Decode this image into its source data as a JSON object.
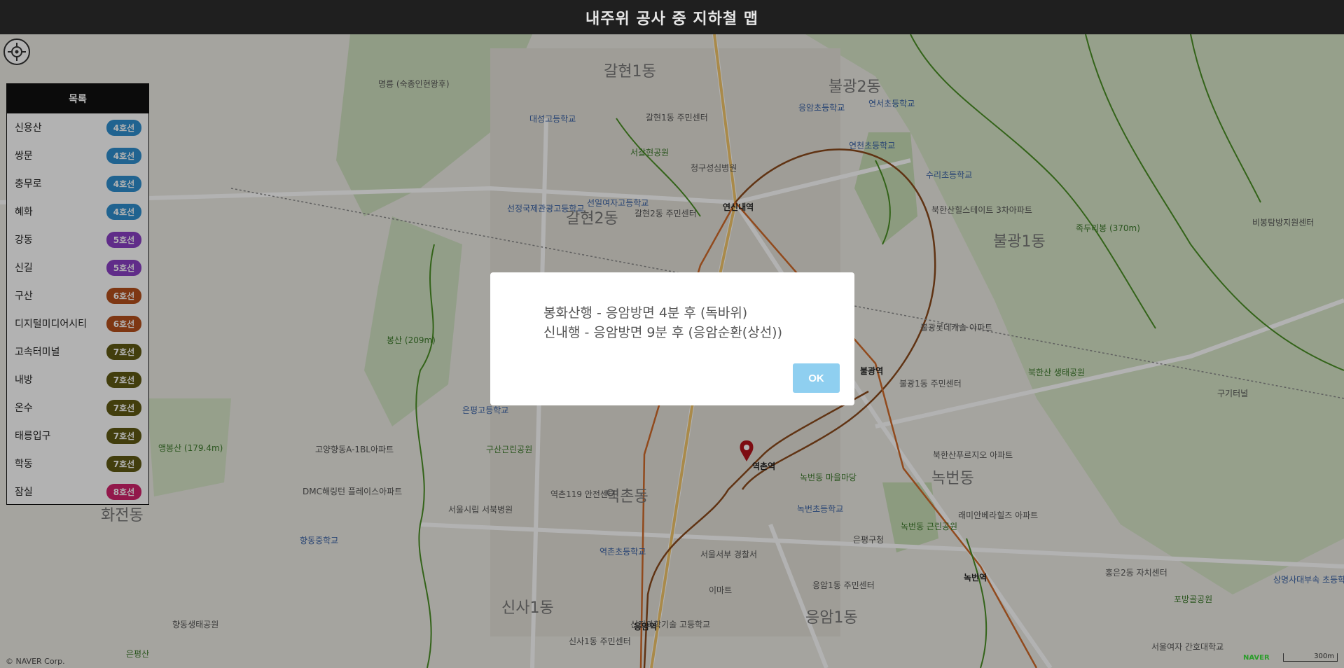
{
  "header": {
    "title": "내주위 공사 중 지하철 맵"
  },
  "panel": {
    "title": "목록",
    "items": [
      {
        "name": "신용산",
        "line": "4호선",
        "color": "#2e8fcf"
      },
      {
        "name": "쌍문",
        "line": "4호선",
        "color": "#2e8fcf"
      },
      {
        "name": "충무로",
        "line": "4호선",
        "color": "#2e8fcf"
      },
      {
        "name": "혜화",
        "line": "4호선",
        "color": "#2e8fcf"
      },
      {
        "name": "강동",
        "line": "5호선",
        "color": "#8a3fc4"
      },
      {
        "name": "신길",
        "line": "5호선",
        "color": "#8a3fc4"
      },
      {
        "name": "구산",
        "line": "6호선",
        "color": "#b5501c"
      },
      {
        "name": "디지털미디어시티",
        "line": "6호선",
        "color": "#b5501c"
      },
      {
        "name": "고속터미널",
        "line": "7호선",
        "color": "#5f5a14"
      },
      {
        "name": "내방",
        "line": "7호선",
        "color": "#5f5a14"
      },
      {
        "name": "온수",
        "line": "7호선",
        "color": "#5f5a14"
      },
      {
        "name": "태릉입구",
        "line": "7호선",
        "color": "#5f5a14"
      },
      {
        "name": "학동",
        "line": "7호선",
        "color": "#5f5a14"
      },
      {
        "name": "잠실",
        "line": "8호선",
        "color": "#d2236c"
      }
    ]
  },
  "dialog": {
    "line1": "봉화산행 - 응암방면 4분 후 (독바위)",
    "line2": "신내행 - 응암방면 9분 후 (응암순환(상선))",
    "ok_label": "OK"
  },
  "map": {
    "districts": [
      "갈현1동",
      "갈현2동",
      "불광2동",
      "불광1동",
      "역촌동",
      "녹번동",
      "신사1동",
      "응암1동",
      "화전동"
    ],
    "stations": [
      "연신내역",
      "불광역",
      "역촌역",
      "녹번역",
      "응암역"
    ],
    "pois": [
      "명릉 (숙종인현왕후)",
      "대성고등학교",
      "서갈현공원",
      "청구성심병원",
      "선일여자고등학교",
      "갈현2동 주민센터",
      "선정국제관광고등학교",
      "수리초등학교",
      "북한산힐스테이트 3차아파트",
      "족두리봉 (370m)",
      "비봉탐방지원센터",
      "봉산 (209m)",
      "은평고등학교",
      "구산근린공원",
      "역촌119 안전센터",
      "서울시립 서북병원",
      "고양향동A-1BL아파트",
      "DMC해링턴 플레이스아파트",
      "향동중학교",
      "역촌초등학교",
      "녹번초등학교",
      "은평구청",
      "서울서부 경찰서",
      "이마트",
      "신진과학기술 고등학교",
      "신사1동 주민센터",
      "응암1동 주민센터",
      "북한산푸르지오 아파트",
      "래미안베라힐즈 아파트",
      "홍은2동 자치센터",
      "포방골공원",
      "상명사대부속 초등학교",
      "서울여자 간호대학교",
      "앵봉산 (179.4m)",
      "향동생태공원",
      "은평산",
      "연천초등학교",
      "불광롯데캐슬 아파트",
      "불광1동 주민센터",
      "북한산 생태공원",
      "구기터널",
      "연서초등학교",
      "갈현1동 주민센터",
      "녹번동 근린공원",
      "녹번동 마을마당",
      "응암초등학교"
    ],
    "copyright": "© NAVER Corp.",
    "logo": "NAVER",
    "scale": "300m"
  }
}
